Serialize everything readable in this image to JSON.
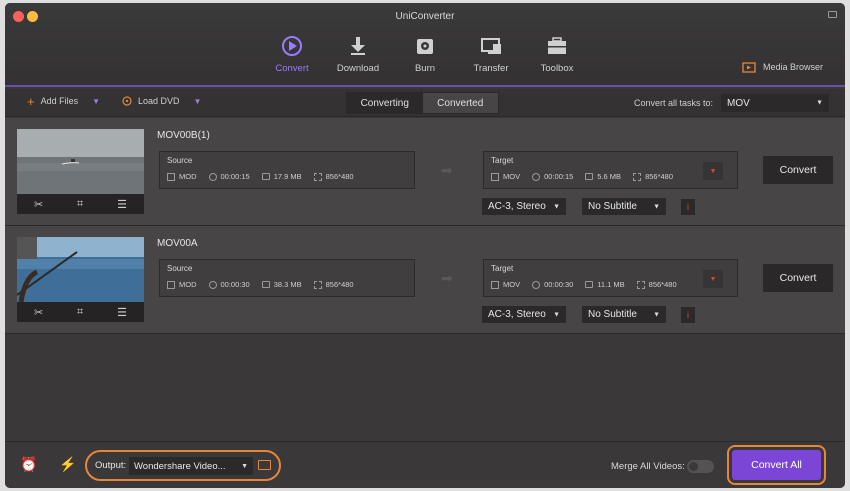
{
  "window": {
    "title": "UniConverter"
  },
  "nav": [
    {
      "label": "Convert",
      "icon": "convert-icon",
      "active": true
    },
    {
      "label": "Download",
      "icon": "download-icon"
    },
    {
      "label": "Burn",
      "icon": "burn-icon"
    },
    {
      "label": "Transfer",
      "icon": "transfer-icon"
    },
    {
      "label": "Toolbox",
      "icon": "toolbox-icon"
    }
  ],
  "media_browser": {
    "label": "Media Browser",
    "icon": "media-browser-icon"
  },
  "toolbar": {
    "add_files": "Add Files",
    "load_dvd": "Load DVD",
    "tabs": [
      "Converting",
      "Converted"
    ],
    "convert_all_label": "Convert all tasks to:",
    "convert_all_value": "MOV"
  },
  "tasks": [
    {
      "name": "MOV00B(1)",
      "source": {
        "label": "Source",
        "format": "MOD",
        "duration": "00:00:15",
        "size": "17.9 MB",
        "resolution": "856*480"
      },
      "target": {
        "label": "Target",
        "format": "MOV",
        "duration": "00:00:15",
        "size": "5.6 MB",
        "resolution": "856*480"
      },
      "audio": "AC-3, Stereo",
      "subtitle": "No Subtitle",
      "info": "i",
      "convert": "Convert"
    },
    {
      "name": "MOV00A",
      "source": {
        "label": "Source",
        "format": "MOD",
        "duration": "00:00:30",
        "size": "38.3 MB",
        "resolution": "856*480"
      },
      "target": {
        "label": "Target",
        "format": "MOV",
        "duration": "00:00:30",
        "size": "11.1 MB",
        "resolution": "856*480"
      },
      "audio": "AC-3, Stereo",
      "subtitle": "No Subtitle",
      "info": "i",
      "convert": "Convert"
    }
  ],
  "footer": {
    "output_label": "Output:",
    "output_value": "Wondershare Video...",
    "merge_label": "Merge All Videos:",
    "merge_on": false,
    "convert_all": "Convert All"
  },
  "colors": {
    "accent": "#7b46d6",
    "highlight": "#e4873a",
    "nav_active": "#9b7bff",
    "danger": "#d8443a"
  }
}
